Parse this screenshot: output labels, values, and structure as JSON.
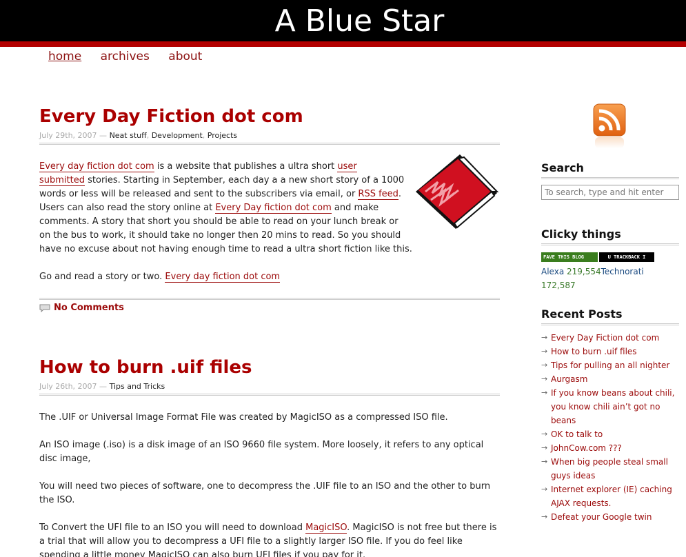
{
  "site": {
    "title": "A Blue Star"
  },
  "nav": [
    {
      "label": "home",
      "current": true
    },
    {
      "label": "archives"
    },
    {
      "label": "about"
    }
  ],
  "posts": [
    {
      "title": "Every Day Fiction dot com",
      "date": "July 29th, 2007",
      "dash": " — ",
      "categories": [
        "Neat stuff",
        "Development",
        "Projects"
      ],
      "p1": {
        "link1": "Every day fiction dot com",
        "t1": " is a website that publishes a ultra short ",
        "link2": "user submitted",
        "t2": " stories. Starting in September, each day a a new short story of a 1000 words or less will be released and sent to the subscribers via email, or ",
        "link3": "RSS feed",
        "t3": ". Users can also read the story online at ",
        "link4": "Every Day fiction dot com",
        "t4": " and make comments. A story that short you should be able to read on your lunch break or on the bus to work, it should take no longer then 20 mins to read. So you should have no excuse about not having enough time to read a ultra short fiction like this."
      },
      "p2": {
        "text": "Go and read a story or two. ",
        "link": "Every day fiction dot com"
      },
      "comments": "No Comments"
    },
    {
      "title": "How to burn .uif files",
      "date": "July 26th, 2007",
      "dash": " — ",
      "categories": [
        "Tips and Tricks"
      ],
      "paragraphs": [
        "The .UIF or Universal Image Format File was created by MagicISO as a compressed ISO file.",
        "An ISO image (.iso) is a disk image of an ISO 9660 file system. More loosely, it refers to any optical disc image,",
        "You will need two pieces of software, one to decompress the .UIF file to an ISO and the other to burn the ISO."
      ],
      "p4": {
        "t1": "To Convert the UFI file to an ISO you will need to download ",
        "link": "MagicISO",
        "t2": ". MagicISO is not free but there is a trial that will allow you to decompress a UFI file to a slightly larger ISO file. If you do feel like spending a little money MagicISO can also burn UFI files if you pay for it."
      }
    }
  ],
  "sidebar": {
    "rss_icon": "rss-feed-icon",
    "search": {
      "title": "Search",
      "placeholder": "To search, type and hit enter"
    },
    "clicky": {
      "title": "Clicky things",
      "badge1": "FAVE THIS BLOG TECHNORATI",
      "badge2": "U TRACKBACK I FOLLOW",
      "alexa_label": "Alexa ",
      "alexa_value": "219,554",
      "technorati_label": "Technorati",
      "technorati_value": "172,587"
    },
    "recent": {
      "title": "Recent Posts",
      "items": [
        "Every Day Fiction dot com",
        "How to burn .uif files",
        "Tips for pulling an all nighter",
        "Aurgasm",
        "If you know beans about chili, you know chili ain’t got no beans",
        "OK to talk to",
        "JohnCow.com ???",
        "When big people steal small guys ideas",
        "Internet explorer (IE) caching AJAX requests.",
        "Defeat your Google twin"
      ]
    }
  },
  "colors": {
    "accent": "#a00000",
    "header_bg": "#000000",
    "header_bar": "#b30000"
  }
}
